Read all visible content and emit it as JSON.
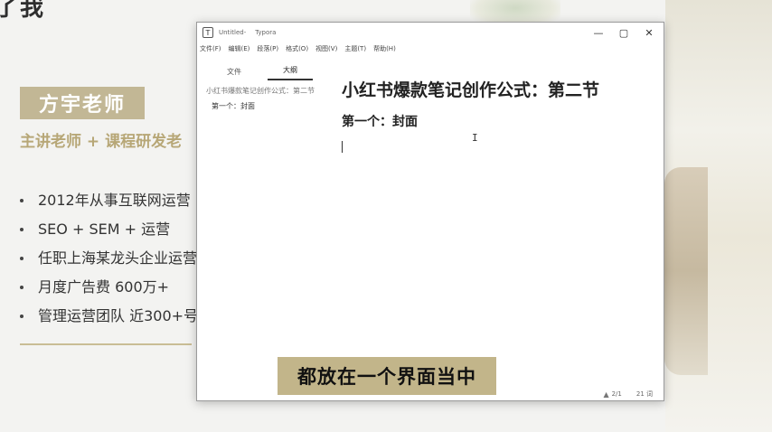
{
  "slide": {
    "top_title": "了我",
    "name_badge": "方宇老师",
    "role": "主讲老师 + 课程研发老",
    "bullets": [
      "2012年从事互联网运营",
      "SEO + SEM + 运营",
      "任职上海某龙头企业运营",
      "月度广告费 600万+",
      "管理运营团队 近300+号"
    ]
  },
  "window": {
    "app_icon": "T",
    "doc_name": "Untitled-",
    "app_name": "Typora",
    "controls": [
      "—",
      "▢",
      "✕"
    ],
    "menu": [
      "文件(F)",
      "编辑(E)",
      "段落(P)",
      "格式(O)",
      "视图(V)",
      "主题(T)",
      "帮助(H)"
    ],
    "sidebar_tabs": [
      "文件",
      "大纲"
    ],
    "outline": {
      "h1": "小红书爆款笔记创作公式：第二节",
      "h2": "第一个：封面"
    },
    "document": {
      "h1": "小红书爆款笔记创作公式：第二节",
      "h2": "第一个：封面"
    },
    "status": {
      "warning": "▲",
      "lines": "2/1",
      "words": "21 词"
    }
  },
  "subtitle": "都放在一个界面当中",
  "colors": {
    "accent_gold": "#c2b795",
    "role_text": "#b7a777",
    "subtitle_bg": "#c2b58a"
  }
}
